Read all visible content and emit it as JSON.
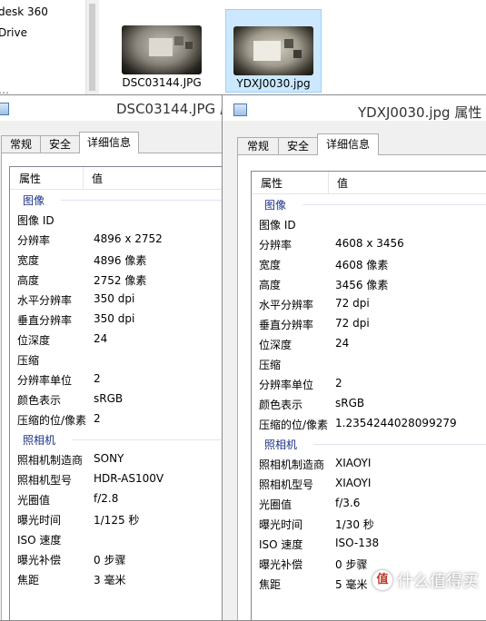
{
  "explorer": {
    "nav_items": [
      "desk 360",
      "Drive",
      "…"
    ],
    "files": [
      {
        "name": "DSC03144.JPG",
        "selected": false
      },
      {
        "name": "YDXJ0030.jpg",
        "selected": true
      }
    ]
  },
  "left_window": {
    "title": "DSC03144.JPG 属性",
    "tabs": [
      "常规",
      "安全",
      "详细信息"
    ],
    "active_tab": "详细信息",
    "col_headers": [
      "属性",
      "值"
    ],
    "rows": [
      {
        "group": "图像"
      },
      {
        "k": "图像 ID",
        "v": ""
      },
      {
        "k": "分辨率",
        "v": "4896 x 2752"
      },
      {
        "k": "宽度",
        "v": "4896 像素"
      },
      {
        "k": "高度",
        "v": "2752 像素"
      },
      {
        "k": "水平分辨率",
        "v": "350 dpi"
      },
      {
        "k": "垂直分辨率",
        "v": "350 dpi"
      },
      {
        "k": "位深度",
        "v": "24"
      },
      {
        "k": "压缩",
        "v": ""
      },
      {
        "k": "分辨率单位",
        "v": "2"
      },
      {
        "k": "颜色表示",
        "v": "sRGB"
      },
      {
        "k": "压缩的位/像素",
        "v": "2"
      },
      {
        "group": "照相机"
      },
      {
        "k": "照相机制造商",
        "v": "SONY"
      },
      {
        "k": "照相机型号",
        "v": "HDR-AS100V"
      },
      {
        "k": "光圈值",
        "v": "f/2.8"
      },
      {
        "k": "曝光时间",
        "v": "1/125 秒"
      },
      {
        "k": "ISO 速度",
        "v": ""
      },
      {
        "k": "曝光补偿",
        "v": "0 步骤"
      },
      {
        "k": "焦距",
        "v": "3 毫米"
      }
    ]
  },
  "right_window": {
    "title": "YDXJ0030.jpg 属性",
    "tabs": [
      "常规",
      "安全",
      "详细信息"
    ],
    "active_tab": "详细信息",
    "col_headers": [
      "属性",
      "值"
    ],
    "rows": [
      {
        "group": "图像"
      },
      {
        "k": "图像 ID",
        "v": ""
      },
      {
        "k": "分辨率",
        "v": "4608 x 3456"
      },
      {
        "k": "宽度",
        "v": "4608 像素"
      },
      {
        "k": "高度",
        "v": "3456 像素"
      },
      {
        "k": "水平分辨率",
        "v": "72 dpi"
      },
      {
        "k": "垂直分辨率",
        "v": "72 dpi"
      },
      {
        "k": "位深度",
        "v": "24"
      },
      {
        "k": "压缩",
        "v": ""
      },
      {
        "k": "分辨率单位",
        "v": "2"
      },
      {
        "k": "颜色表示",
        "v": "sRGB"
      },
      {
        "k": "压缩的位/像素",
        "v": "1.2354244028099279"
      },
      {
        "group": "照相机"
      },
      {
        "k": "照相机制造商",
        "v": "XIAOYI"
      },
      {
        "k": "照相机型号",
        "v": "XIAOYI"
      },
      {
        "k": "光圈值",
        "v": "f/3.6"
      },
      {
        "k": "曝光时间",
        "v": "1/30 秒"
      },
      {
        "k": "ISO 速度",
        "v": "ISO-138"
      },
      {
        "k": "曝光补偿",
        "v": "0 步骤"
      },
      {
        "k": "焦距",
        "v": "5 毫米"
      }
    ]
  },
  "watermark": {
    "badge": "值",
    "text": "什么值得买"
  },
  "colors": {
    "group_text": "#1e3287",
    "selection": "#cce8ff",
    "window_bg": "#f0f0f0"
  }
}
